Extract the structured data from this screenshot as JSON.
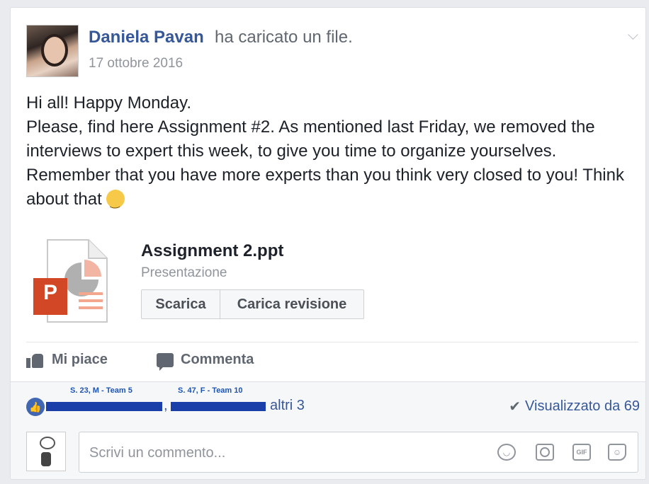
{
  "post": {
    "author": "Daniela Pavan",
    "action": "ha caricato un file.",
    "date": "17 ottobre 2016",
    "body_lines": [
      "Hi all! Happy Monday.",
      "Please, find here Assignment #2. As mentioned last Friday, we removed the interviews to expert this week, to give you time to organize yourselves. Remember that you have more experts than you think very closed to you! Think about that"
    ]
  },
  "attachment": {
    "name": "Assignment 2.ppt",
    "type": "Presentazione",
    "icon_letter": "P",
    "download_label": "Scarica",
    "upload_revision_label": "Carica revisione"
  },
  "actions": {
    "like_label": "Mi piace",
    "comment_label": "Commenta"
  },
  "reactions": {
    "annotation_1": "S. 23, M - Team 5",
    "annotation_2": "S. 47, F - Team 10",
    "separator": ",",
    "others": "altri 3",
    "seen_by": "Visualizzato da 69"
  },
  "comment_box": {
    "placeholder": "Scrivi un commento...",
    "icons": [
      "emoji-icon",
      "camera-icon",
      "gif-icon",
      "sticker-icon"
    ],
    "gif_label": "GIF"
  },
  "colors": {
    "link_blue": "#365899",
    "annotation_blue": "#1e55b3",
    "ppt_orange": "#d24726"
  }
}
